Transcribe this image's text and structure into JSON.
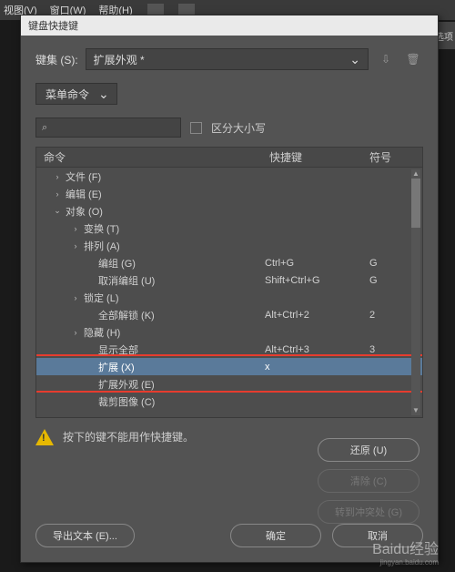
{
  "menubar": {
    "items": [
      "视图(V)",
      "窗口(W)",
      "帮助(H)"
    ],
    "icons": [
      "Br",
      "St"
    ]
  },
  "side_tab": "首选项",
  "dialog": {
    "title": "键盘快捷键",
    "set_label": "键集 (S):",
    "set_value": "扩展外观 *",
    "scope_label": "菜单命令",
    "search_placeholder": "",
    "case_label": "区分大小写",
    "columns": {
      "cmd": "命令",
      "key": "快捷键",
      "sym": "符号"
    },
    "rows": [
      {
        "indent": 1,
        "caret": ">",
        "label": "文件 (F)",
        "key": "",
        "sym": ""
      },
      {
        "indent": 1,
        "caret": ">",
        "label": "编辑 (E)",
        "key": "",
        "sym": ""
      },
      {
        "indent": 1,
        "caret": "v",
        "label": "对象 (O)",
        "key": "",
        "sym": ""
      },
      {
        "indent": 2,
        "caret": ">",
        "label": "变换 (T)",
        "key": "",
        "sym": ""
      },
      {
        "indent": 2,
        "caret": ">",
        "label": "排列 (A)",
        "key": "",
        "sym": ""
      },
      {
        "indent": 3,
        "caret": "",
        "label": "编组 (G)",
        "key": "Ctrl+G",
        "sym": "G"
      },
      {
        "indent": 3,
        "caret": "",
        "label": "取消编组 (U)",
        "key": "Shift+Ctrl+G",
        "sym": "G"
      },
      {
        "indent": 2,
        "caret": ">",
        "label": "锁定 (L)",
        "key": "",
        "sym": ""
      },
      {
        "indent": 3,
        "caret": "",
        "label": "全部解锁 (K)",
        "key": "Alt+Ctrl+2",
        "sym": "2"
      },
      {
        "indent": 2,
        "caret": ">",
        "label": "隐藏 (H)",
        "key": "",
        "sym": ""
      },
      {
        "indent": 3,
        "caret": "",
        "label": "显示全部",
        "key": "Alt+Ctrl+3",
        "sym": "3"
      },
      {
        "indent": 3,
        "caret": "",
        "label": "扩展 (X)",
        "key": "x",
        "sym": "",
        "selected": true
      },
      {
        "indent": 3,
        "caret": "",
        "label": "扩展外观 (E)",
        "key": "",
        "sym": ""
      },
      {
        "indent": 3,
        "caret": "",
        "label": "裁剪图像 (C)",
        "key": "",
        "sym": ""
      }
    ],
    "warn_msg": "按下的键不能用作快捷键。",
    "buttons": {
      "undo": "还原 (U)",
      "clear": "清除 (C)",
      "goto": "转到冲突处 (G)",
      "export": "导出文本 (E)...",
      "ok": "确定",
      "cancel": "取消"
    }
  },
  "watermark": {
    "brand": "Baidu经验",
    "url": "jingyan.baidu.com"
  }
}
